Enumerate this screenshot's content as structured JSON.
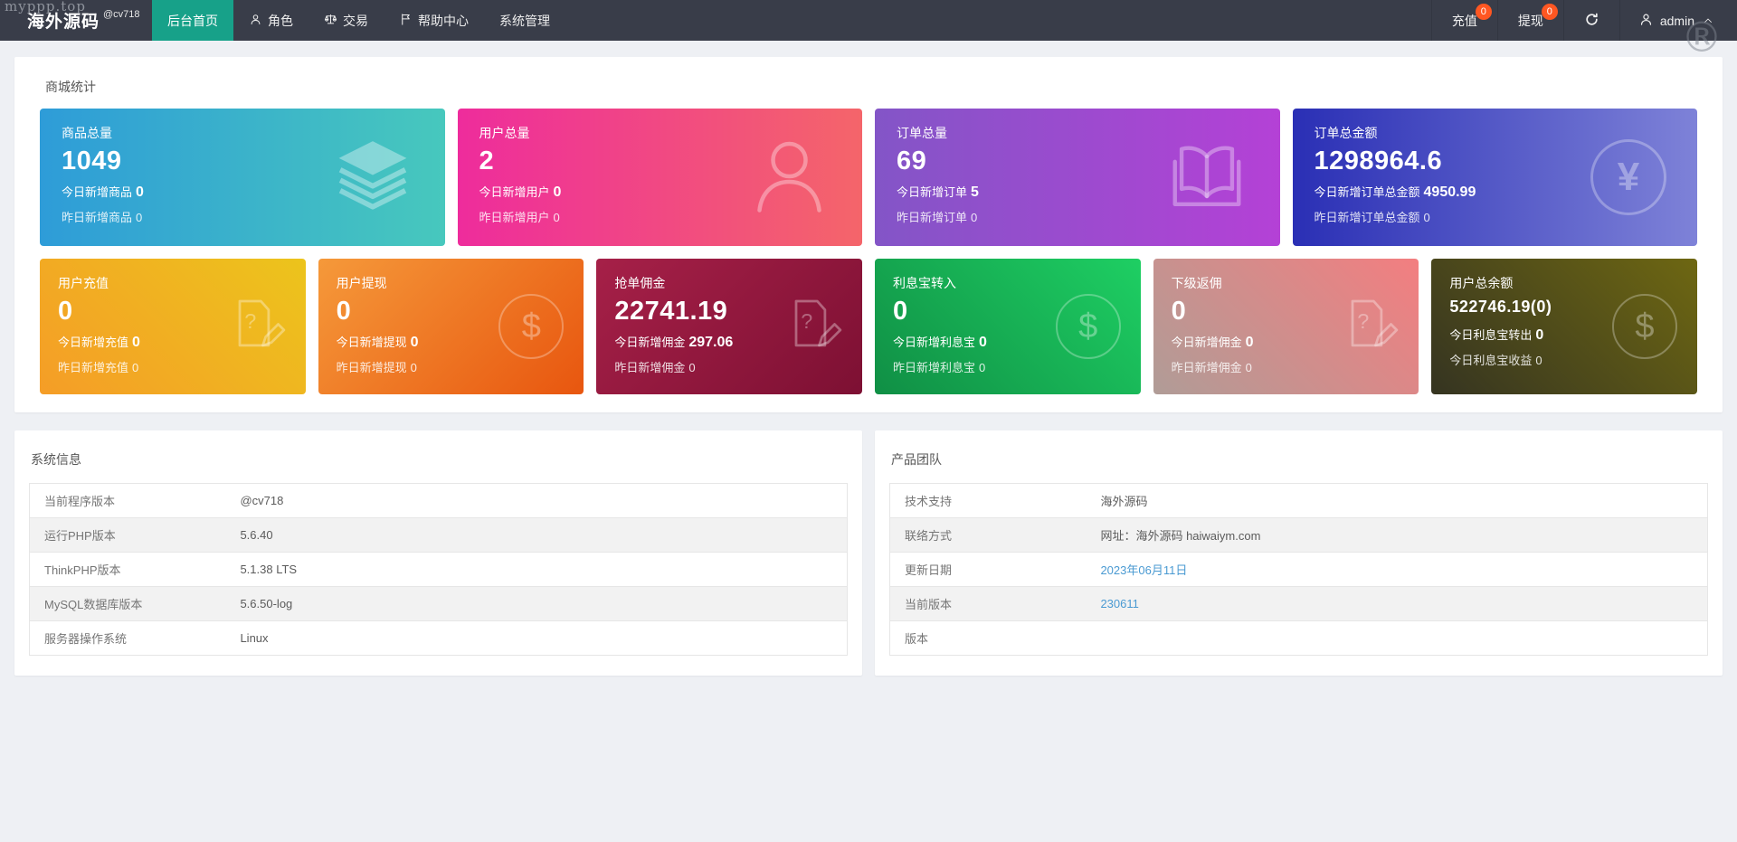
{
  "watermarks": {
    "site": "myppp.top",
    "registered": "®"
  },
  "colors": {
    "navbar_bg": "#393d49",
    "active_tab": "#17a189",
    "badge": "#ff5722",
    "link": "#4a9ad2",
    "page_bg": "#eef0f4",
    "card_gradients": {
      "goods": [
        "#2e9cd8",
        "#47c8bd"
      ],
      "users": [
        "#ee2c9c",
        "#f4656a"
      ],
      "orders": [
        "#8355c7",
        "#b441d6"
      ],
      "order_amount": [
        "#2a2fb5",
        "#7e82d8"
      ],
      "recharge": [
        "#f59d27",
        "#ecc41c"
      ],
      "withdraw": [
        "#f5993a",
        "#e8560f"
      ],
      "commission": [
        "#a62048",
        "#7d1033"
      ],
      "interest_in": [
        "#108f45",
        "#1ecf63"
      ],
      "sub_rebate": [
        "#b09c97",
        "#f37e80"
      ],
      "balance": [
        "#353421",
        "#6e6712"
      ]
    }
  },
  "navbar": {
    "logo": "海外源码",
    "logo_super": "@cv718",
    "items": [
      {
        "label": "后台首页",
        "active": true
      },
      {
        "label": "角色",
        "icon": "user-icon"
      },
      {
        "label": "交易",
        "icon": "scale-icon"
      },
      {
        "label": "帮助中心",
        "icon": "flag-icon"
      },
      {
        "label": "系统管理"
      }
    ],
    "actions": {
      "recharge": {
        "label": "充值",
        "badge": "0"
      },
      "withdraw": {
        "label": "提现",
        "badge": "0"
      },
      "refresh_icon": "refresh-icon",
      "user": {
        "name": "admin",
        "icon": "user-icon",
        "chevron": "chevron-up-icon"
      }
    }
  },
  "stats_panel": {
    "title": "商城统计",
    "big_cards": [
      {
        "title": "商品总量",
        "value": "1049",
        "today_label": "今日新增商品",
        "today_value": "0",
        "yesterday_label": "昨日新增商品",
        "yesterday_value": "0",
        "icon": "layers-icon"
      },
      {
        "title": "用户总量",
        "value": "2",
        "today_label": "今日新增用户",
        "today_value": "0",
        "yesterday_label": "昨日新增用户",
        "yesterday_value": "0",
        "icon": "person-icon"
      },
      {
        "title": "订单总量",
        "value": "69",
        "today_label": "今日新增订单",
        "today_value": "5",
        "yesterday_label": "昨日新增订单",
        "yesterday_value": "0",
        "icon": "book-icon"
      },
      {
        "title": "订单总金额",
        "value": "1298964.6",
        "today_label": "今日新增订单总金额",
        "today_value": "4950.99",
        "yesterday_label": "昨日新增订单总金额",
        "yesterday_value": "0",
        "icon": "yen-circle-icon"
      }
    ],
    "small_cards": [
      {
        "title": "用户充值",
        "value": "0",
        "today_label": "今日新增充值",
        "today_value": "0",
        "yesterday_label": "昨日新增充值",
        "yesterday_value": "0",
        "icon": "doc-pencil-icon"
      },
      {
        "title": "用户提现",
        "value": "0",
        "today_label": "今日新增提现",
        "today_value": "0",
        "yesterday_label": "昨日新增提现",
        "yesterday_value": "0",
        "icon": "dollar-circle-icon"
      },
      {
        "title": "抢单佣金",
        "value": "22741.19",
        "today_label": "今日新增佣金",
        "today_value": "297.06",
        "yesterday_label": "昨日新增佣金",
        "yesterday_value": "0",
        "icon": "doc-pencil-icon"
      },
      {
        "title": "利息宝转入",
        "value": "0",
        "today_label": "今日新增利息宝",
        "today_value": "0",
        "yesterday_label": "昨日新增利息宝",
        "yesterday_value": "0",
        "icon": "dollar-circle-icon"
      },
      {
        "title": "下级返佣",
        "value": "0",
        "today_label": "今日新增佣金",
        "today_value": "0",
        "yesterday_label": "昨日新增佣金",
        "yesterday_value": "0",
        "icon": "doc-pencil-icon"
      },
      {
        "title": "用户总余额",
        "value": "522746.19(0)",
        "today_label": "今日利息宝转出",
        "today_value": "0",
        "yesterday_label": "今日利息宝收益",
        "yesterday_value": "0",
        "icon": "dollar-circle-icon"
      }
    ]
  },
  "system_info": {
    "title": "系统信息",
    "rows": [
      [
        "当前程序版本",
        "@cv718"
      ],
      [
        "运行PHP版本",
        "5.6.40"
      ],
      [
        "ThinkPHP版本",
        "5.1.38 LTS"
      ],
      [
        "MySQL数据库版本",
        "5.6.50-log"
      ],
      [
        "服务器操作系统",
        "Linux"
      ]
    ]
  },
  "product_team": {
    "title": "产品团队",
    "rows": [
      [
        "技术支持",
        "海外源码"
      ],
      [
        "联络方式",
        "网址：海外源码 haiwaiym.com"
      ],
      [
        "更新日期",
        "2023年06月11日"
      ],
      [
        "当前版本",
        "230611"
      ],
      [
        "版本",
        ""
      ]
    ]
  }
}
